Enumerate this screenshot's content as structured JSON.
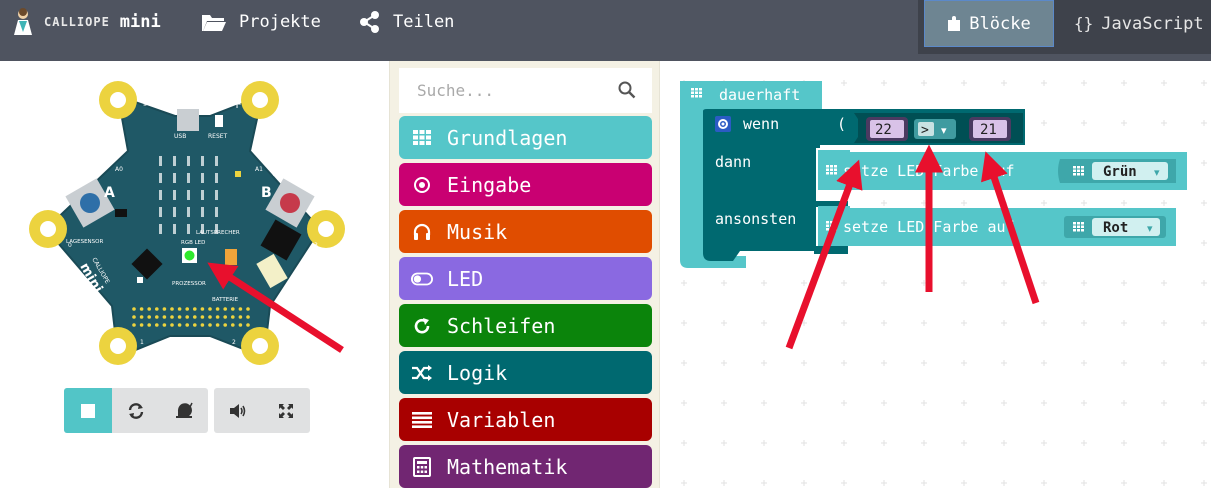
{
  "header": {
    "brand_name": "CALLIOPE",
    "brand_suffix": "mini",
    "nav": [
      {
        "label": "Projekte",
        "icon": "folder-icon"
      },
      {
        "label": "Teilen",
        "icon": "share-icon"
      }
    ],
    "tabs": [
      {
        "label": "Blöcke",
        "icon": "puzzle-icon",
        "active": true
      },
      {
        "label": "JavaScript",
        "icon": "braces-icon",
        "prefix": "{}",
        "active": false
      }
    ]
  },
  "simulator": {
    "board_labels": {
      "minus": "-",
      "plus": "+",
      "usb": "USB",
      "reset": "RESET",
      "a0": "A0",
      "a1": "A1",
      "button_a": "A",
      "button_b": "B",
      "lagesensor": "LAGESENSOR",
      "lautsprecher": "LAUTSPRECHER",
      "rgb_led": "RGB LED",
      "prozessor": "PROZESSOR",
      "batterie": "BATTERIE",
      "pin0": "0",
      "pin1": "1",
      "pin2": "2",
      "pin3": "3",
      "logo_text": "CALLIOPE",
      "logo_mini": "mini"
    },
    "rgb_led_color": "#2ee82e",
    "controls": [
      {
        "name": "stop-button",
        "icon": "stop-icon",
        "active": true
      },
      {
        "name": "restart-button",
        "icon": "restart-icon",
        "active": false
      },
      {
        "name": "slow-motion-button",
        "icon": "snail-icon",
        "active": false
      },
      {
        "name": "mute-button",
        "icon": "speaker-icon",
        "active": false
      },
      {
        "name": "fullscreen-button",
        "icon": "fullscreen-icon",
        "active": false
      }
    ]
  },
  "toolbox": {
    "search_placeholder": "Suche...",
    "categories": [
      {
        "label": "Grundlagen",
        "color": "#55c6c9",
        "icon": "grid-icon"
      },
      {
        "label": "Eingabe",
        "color": "#c90072",
        "icon": "radio-target-icon"
      },
      {
        "label": "Musik",
        "color": "#e04d00",
        "icon": "headphones-icon"
      },
      {
        "label": "LED",
        "color": "#8a69e1",
        "icon": "toggle-icon"
      },
      {
        "label": "Schleifen",
        "color": "#0b840b",
        "icon": "loop-icon"
      },
      {
        "label": "Logik",
        "color": "#006970",
        "icon": "shuffle-icon"
      },
      {
        "label": "Variablen",
        "color": "#a80000",
        "icon": "list-icon"
      },
      {
        "label": "Mathematik",
        "color": "#712672",
        "icon": "calculator-icon"
      }
    ]
  },
  "workspace": {
    "forever_label": "dauerhaft",
    "if_label": "wenn",
    "then_label": "dann",
    "else_label": "ansonsten",
    "left_operand": "22",
    "operator": ">",
    "right_operand": "21",
    "set_led_label": "setze LED-Farbe auf",
    "then_color": "Grün",
    "else_color": "Rot",
    "dropdown_arrow": "▾",
    "paren_open": "(",
    "colors": {
      "basic": "#55c6c9",
      "basic_dark": "#3ea7aa",
      "logic": "#006970",
      "logic_dark": "#004f54",
      "operand_fill": "#d9c2e8",
      "operand_border": "#4b3a61"
    }
  },
  "annotations": {
    "arrow_color": "#e8102d"
  }
}
